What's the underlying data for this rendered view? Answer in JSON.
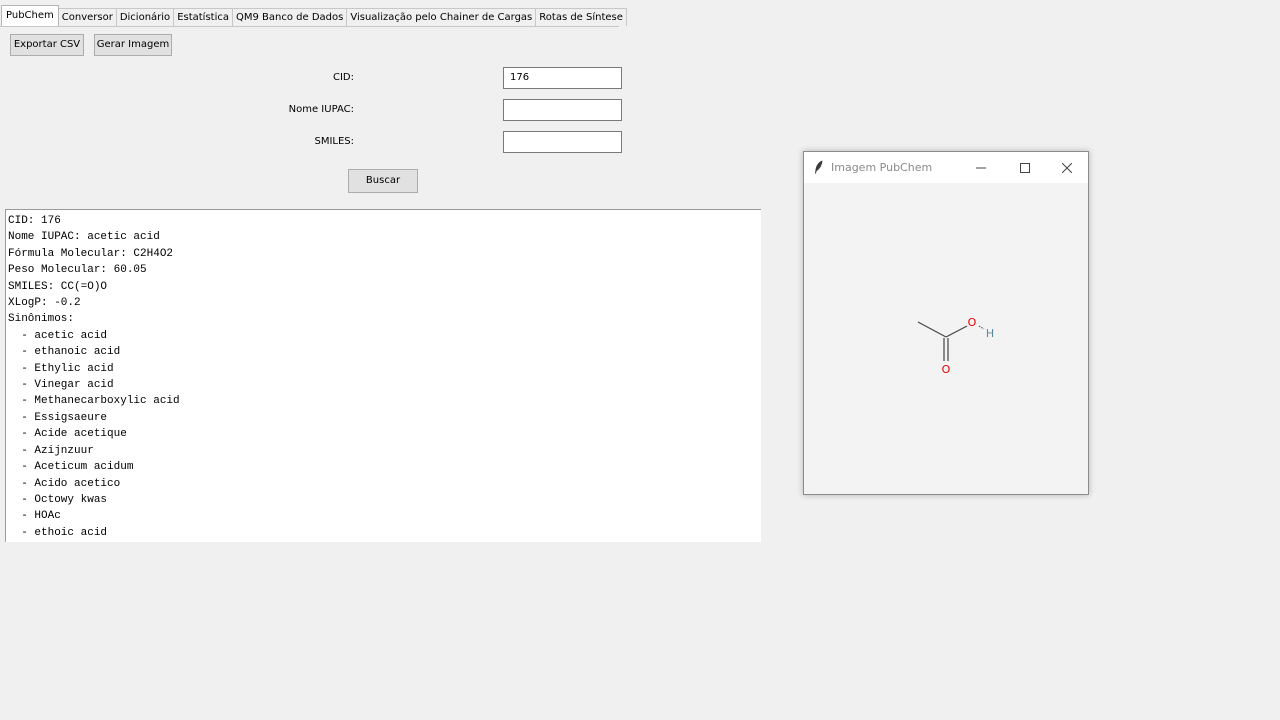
{
  "tabs": [
    {
      "label": "PubChem",
      "active": true
    },
    {
      "label": "Conversor"
    },
    {
      "label": "Dicionário"
    },
    {
      "label": "Estatística"
    },
    {
      "label": "QM9 Banco de Dados"
    },
    {
      "label": "Visualização pelo Chainer de Cargas"
    },
    {
      "label": "Rotas de Síntese"
    }
  ],
  "toolbar": {
    "export_csv": "Exportar CSV",
    "generate_image": "Gerar Imagem"
  },
  "form": {
    "cid_label": "CID:",
    "cid_value": "176",
    "iupac_label": "Nome IUPAC:",
    "iupac_value": "",
    "smiles_label": "SMILES:",
    "smiles_value": "",
    "search_button": "Buscar"
  },
  "output": {
    "lines": [
      "CID: 176",
      "Nome IUPAC: acetic acid",
      "Fórmula Molecular: C2H4O2",
      "Peso Molecular: 60.05",
      "SMILES: CC(=O)O",
      "XLogP: -0.2",
      "Sinônimos:",
      "  - acetic acid",
      "  - ethanoic acid",
      "  - Ethylic acid",
      "  - Vinegar acid",
      "  - Methanecarboxylic acid",
      "  - Essigsaeure",
      "  - Acide acetique",
      "  - Azijnzuur",
      "  - Aceticum acidum",
      "  - Acido acetico",
      "  - Octowy kwas",
      "  - HOAc",
      "  - ethoic acid"
    ]
  },
  "popup": {
    "title": "Imagem PubChem",
    "icon": "feather-icon",
    "atoms": {
      "oxygen_single": "O",
      "hydrogen": "H",
      "oxygen_double": "O"
    },
    "colors": {
      "oxygen": "#e60000",
      "hydrogen": "#5b8a96",
      "bond": "#444444"
    }
  }
}
